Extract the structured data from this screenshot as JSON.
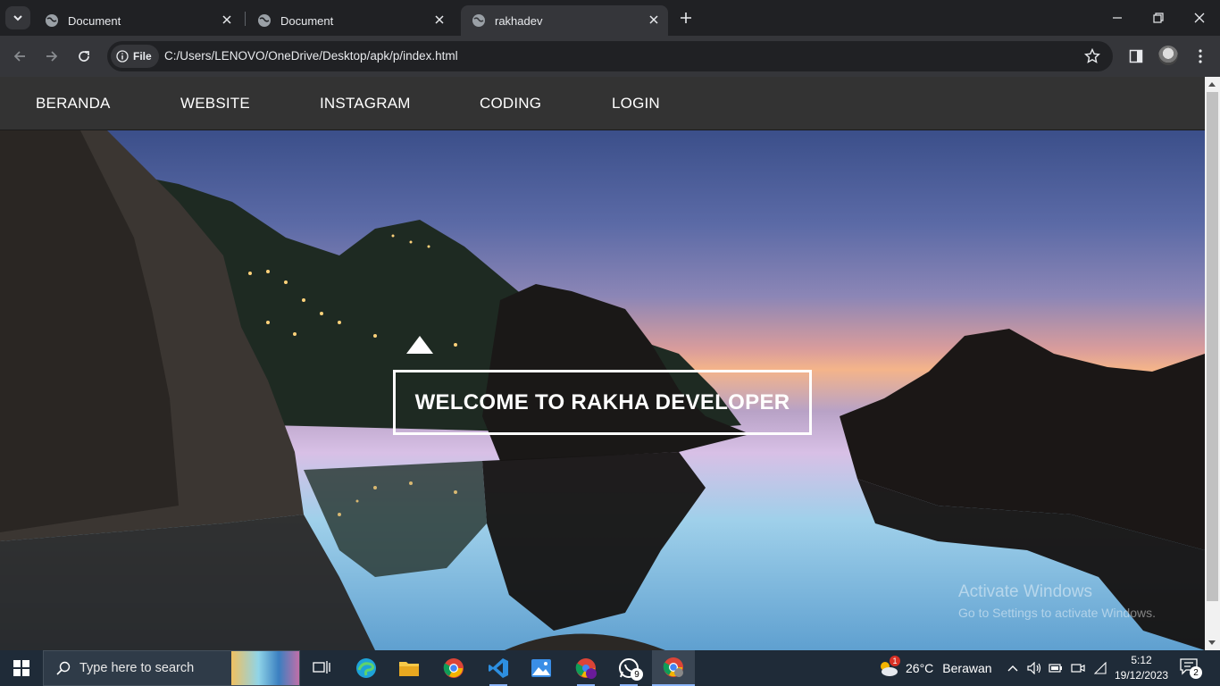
{
  "browser": {
    "tabs": [
      {
        "title": "Document",
        "active": false
      },
      {
        "title": "Document",
        "active": false
      },
      {
        "title": "rakhadev",
        "active": true
      }
    ],
    "site_chip": "File",
    "url": "C:/Users/LENOVO/OneDrive/Desktop/apk/p/index.html"
  },
  "site": {
    "nav": [
      "BERANDA",
      "WEBSITE",
      "INSTAGRAM",
      "CODING",
      "LOGIN"
    ],
    "hero_title": "WELCOME TO RAKHA DEVELOPER"
  },
  "watermark": {
    "title": "Activate Windows",
    "subtitle": "Go to Settings to activate Windows."
  },
  "taskbar": {
    "search_placeholder": "Type here to search",
    "weather_temp": "26°C",
    "weather_desc": "Berawan",
    "weather_badge": "1",
    "whatsapp_badge": "9",
    "time": "5:12",
    "date": "19/12/2023",
    "notification_count": "2"
  },
  "colors": {
    "tab_bar": "#202124",
    "toolbar": "#35363a",
    "site_nav": "#333333",
    "taskbar": "#1f2b38"
  }
}
